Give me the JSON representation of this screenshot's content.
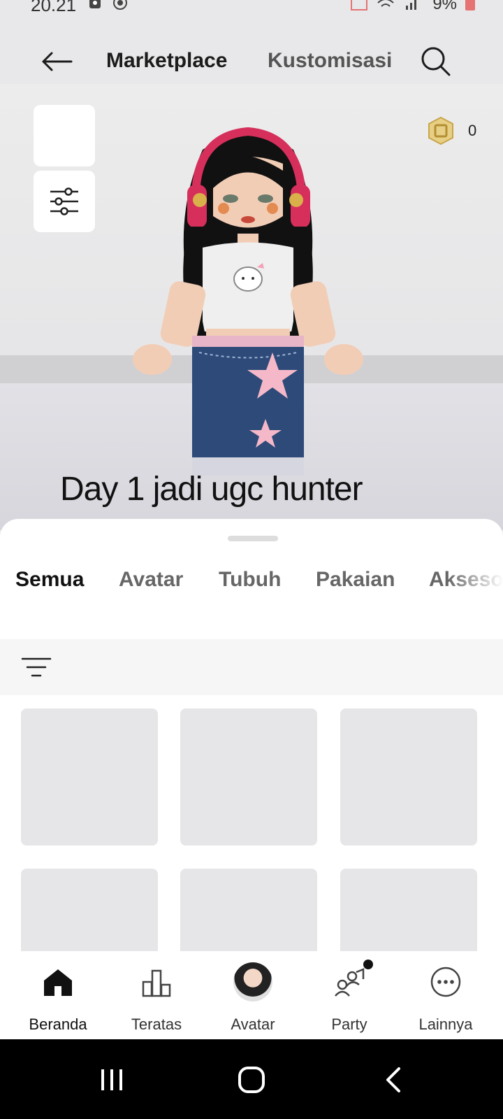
{
  "status": {
    "time": "20.21",
    "battery": "9%"
  },
  "header": {
    "tab_marketplace": "Marketplace",
    "tab_customize": "Kustomisasi"
  },
  "scene": {
    "robux_amount": "0",
    "caption": "Day 1 jadi ugc hunter"
  },
  "categories": [
    "Semua",
    "Avatar",
    "Tubuh",
    "Pakaian",
    "Akseso"
  ],
  "nav": {
    "items": [
      {
        "label": "Beranda",
        "icon": "home-icon"
      },
      {
        "label": "Teratas",
        "icon": "charts-icon"
      },
      {
        "label": "Avatar",
        "icon": "avatar-icon"
      },
      {
        "label": "Party",
        "icon": "party-icon"
      },
      {
        "label": "Lainnya",
        "icon": "more-icon"
      }
    ]
  },
  "colors": {
    "accent": "#111111",
    "robux": "#d8b45a",
    "headphones": "#d62f5b"
  }
}
